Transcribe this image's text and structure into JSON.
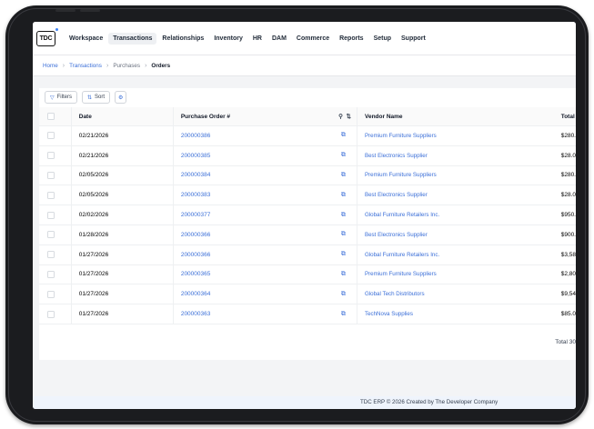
{
  "app": {
    "logo_text": "TDC",
    "nav": [
      "Workspace",
      "Transactions",
      "Relationships",
      "Inventory",
      "HR",
      "DAM",
      "Commerce",
      "Reports",
      "Setup",
      "Support"
    ],
    "active_nav": "Transactions"
  },
  "breadcrumb": {
    "home": "Home",
    "transactions": "Transactions",
    "purchases": "Purchases",
    "current": "Orders"
  },
  "toolbar": {
    "filters_label": "Filters",
    "sort_label": "Sort"
  },
  "table": {
    "columns": {
      "date": "Date",
      "po": "Purchase Order #",
      "vendor": "Vendor Name",
      "total": "Total"
    },
    "rows": [
      {
        "date": "02/21/2026",
        "po": "200000386",
        "vendor": "Premium Furniture Suppliers",
        "total": "$280."
      },
      {
        "date": "02/21/2026",
        "po": "200000385",
        "vendor": "Best Electronics Supplier",
        "total": "$28.0"
      },
      {
        "date": "02/05/2026",
        "po": "200000384",
        "vendor": "Premium Furniture Suppliers",
        "total": "$280."
      },
      {
        "date": "02/05/2026",
        "po": "200000383",
        "vendor": "Best Electronics Supplier",
        "total": "$28.0"
      },
      {
        "date": "02/02/2026",
        "po": "200000377",
        "vendor": "Global Furniture Retailers Inc.",
        "total": "$950."
      },
      {
        "date": "01/28/2026",
        "po": "200000366",
        "vendor": "Best Electronics Supplier",
        "total": "$900."
      },
      {
        "date": "01/27/2026",
        "po": "200000366",
        "vendor": "Global Furniture Retailers Inc.",
        "total": "$3,58"
      },
      {
        "date": "01/27/2026",
        "po": "200000365",
        "vendor": "Premium Furniture Suppliers",
        "total": "$2,80"
      },
      {
        "date": "01/27/2026",
        "po": "200000364",
        "vendor": "Global Tech Distributors",
        "total": "$9,54"
      },
      {
        "date": "01/27/2026",
        "po": "200000363",
        "vendor": "TechNova Supplies",
        "total": "$85.0"
      }
    ],
    "total_text": "Total 30"
  },
  "footer": {
    "text": "TDC ERP © 2026 Created by The Developer Company"
  },
  "colors": {
    "accent": "#3b6fd8",
    "bezel": "#1b1c1f",
    "footer_bg": "#eff4fc"
  }
}
